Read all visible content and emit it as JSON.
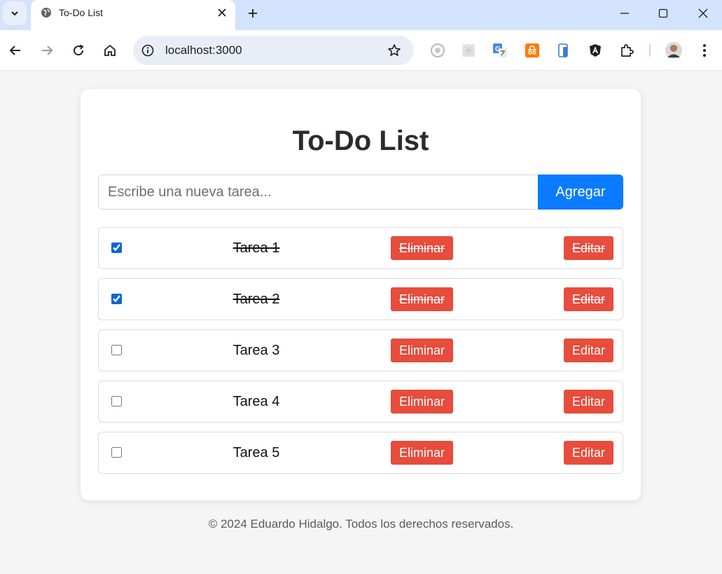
{
  "browser": {
    "tab_title": "To-Do List",
    "url": "localhost:3000",
    "icons": [
      "tab-search-icon",
      "globe-icon",
      "close-icon",
      "plus-icon",
      "minimize-icon",
      "maximize-icon",
      "window-close-icon",
      "back-icon",
      "forward-icon",
      "reload-icon",
      "home-icon",
      "info-icon",
      "star-icon",
      "extensions-icon",
      "profile-avatar",
      "kebab-menu-icon"
    ]
  },
  "app": {
    "title": "To-Do List",
    "input_placeholder": "Escribe una nueva tarea...",
    "add_label": "Agregar",
    "delete_label": "Eliminar",
    "edit_label": "Editar",
    "accent_color": "#0a7bff",
    "danger_color": "#e74c3c",
    "tasks": [
      {
        "label": "Tarea 1",
        "done": true
      },
      {
        "label": "Tarea 2",
        "done": true
      },
      {
        "label": "Tarea 3",
        "done": false
      },
      {
        "label": "Tarea 4",
        "done": false
      },
      {
        "label": "Tarea 5",
        "done": false
      }
    ]
  },
  "footer": {
    "text": "© 2024 Eduardo Hidalgo. Todos los derechos reservados."
  }
}
